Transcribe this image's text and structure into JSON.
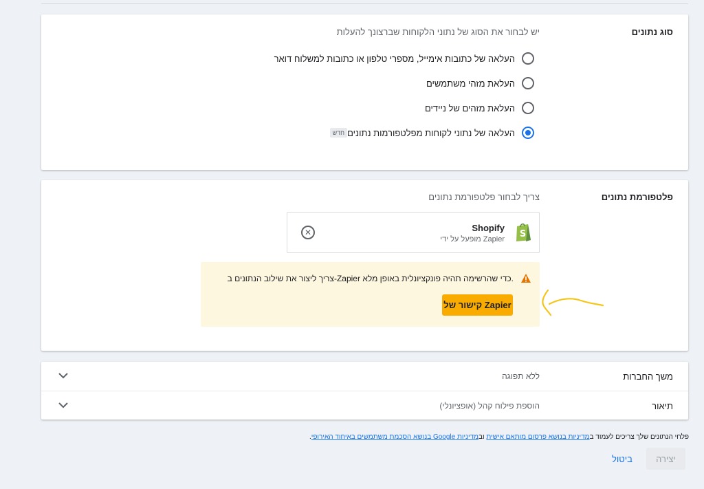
{
  "data_type": {
    "label": "סוג נתונים",
    "hint": "יש לבחור את הסוג של נתוני הלקוחות שברצונך להעלות",
    "options": [
      {
        "label": "העלאה של כתובות אימייל, מספרי טלפון או כתובות למשלוח דואר",
        "selected": false
      },
      {
        "label": "העלאת מזהי משתמשים",
        "selected": false
      },
      {
        "label": "העלאת מזהים של ניידים",
        "selected": false
      },
      {
        "label": "העלאה של נתוני לקוחות מפלטפורמות נתונים",
        "selected": true,
        "badge": "חדש"
      }
    ]
  },
  "data_platform": {
    "label": "פלטפורמת נתונים",
    "hint": "צריך לבחור פלטפורמת נתונים",
    "selected_name": "Shopify",
    "selected_sub": "מופעל על ידי Zapier",
    "warning_text": "צריך ליצור את שילוב הנתונים ב-Zapier כדי שהרשימה תהיה פונקציונלית באופן מלא.",
    "zapier_button": "קישור של Zapier"
  },
  "rows": [
    {
      "label": "משך החברות",
      "value": "ללא תפוגה"
    },
    {
      "label": "תיאור",
      "value": "הוספת פילוח קהל (אופציונלי)"
    }
  ],
  "footer": {
    "prefix": "פלחי הנתונים שלך צריכים לעמוד ב",
    "link1": "מדיניות בנושא פרסום מותאם אישית",
    "middle": " וב",
    "link2": "מדיניות Google בנושא הסכמת משתמשים באיחוד האירופי",
    "suffix": "."
  },
  "actions": {
    "create": "יצירה",
    "cancel": "ביטול"
  },
  "colors": {
    "accent": "#1a73e8",
    "warning_bg": "#fef7e0",
    "zapier_button": "#f9ab00",
    "shopify_green": "#95bf47"
  }
}
